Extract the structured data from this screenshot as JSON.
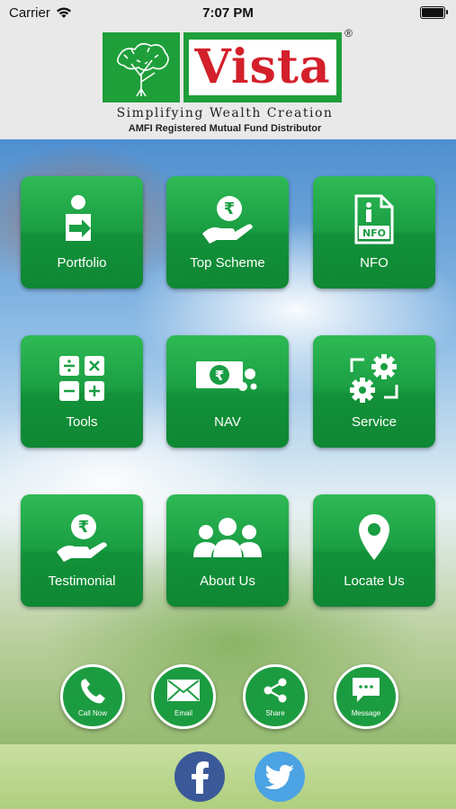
{
  "status_bar": {
    "carrier": "Carrier",
    "time": "7:07 PM"
  },
  "header": {
    "brand": "Vista",
    "registered_mark": "®",
    "tagline": "Simplifying Wealth Creation",
    "subtitle": "AMFI Registered Mutual Fund Distributor"
  },
  "tiles": [
    {
      "label": "Portfolio",
      "icon": "person-arrow-icon"
    },
    {
      "label": "Top Scheme",
      "icon": "rupee-hand-icon"
    },
    {
      "label": "NFO",
      "icon": "nfo-document-icon"
    },
    {
      "label": "Tools",
      "icon": "calculator-icon"
    },
    {
      "label": "NAV",
      "icon": "rupee-note-icon"
    },
    {
      "label": "Service",
      "icon": "gears-icon"
    },
    {
      "label": "Testimonial",
      "icon": "rupee-hand-icon"
    },
    {
      "label": "About Us",
      "icon": "group-icon"
    },
    {
      "label": "Locate Us",
      "icon": "location-pin-icon"
    }
  ],
  "actions": [
    {
      "label": "Call Now",
      "icon": "phone-icon"
    },
    {
      "label": "Email",
      "icon": "envelope-icon"
    },
    {
      "label": "Share",
      "icon": "share-icon"
    },
    {
      "label": "Message",
      "icon": "chat-bubble-icon"
    }
  ],
  "social": [
    {
      "icon": "facebook-icon",
      "color": "#3b5998"
    },
    {
      "icon": "twitter-icon",
      "color": "#4ba3e3"
    }
  ],
  "colors": {
    "brand_green": "#1f9f3a",
    "brand_red": "#d3202a",
    "header_bg": "#e9e9e9"
  }
}
